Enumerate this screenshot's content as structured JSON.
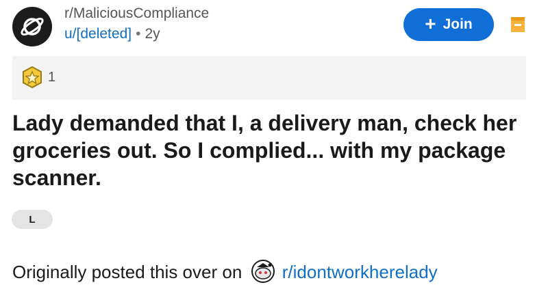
{
  "header": {
    "subreddit": "r/MaliciousCompliance",
    "user": "u/[deleted]",
    "separator": "•",
    "age": "2y",
    "join_label": "Join",
    "join_plus": "+",
    "subreddit_icon": "planet-icon",
    "more_icon": "bookmark-icon"
  },
  "awards": {
    "icon": "star-award-icon",
    "count": "1"
  },
  "post": {
    "title": "Lady demanded that I, a delivery man, check her groceries out. So I complied... with my package scanner.",
    "flair": "L",
    "body_prefix": "Originally posted this over on",
    "body_link": "r/idontworkherelady",
    "link_icon": "snoo-avatar-icon"
  },
  "colors": {
    "accent": "#0f6fd6",
    "link": "#0f6fc6",
    "award_bg": "#f3f3f3",
    "flair_bg": "#e4e4e4",
    "bookmark": "#f5a623"
  }
}
